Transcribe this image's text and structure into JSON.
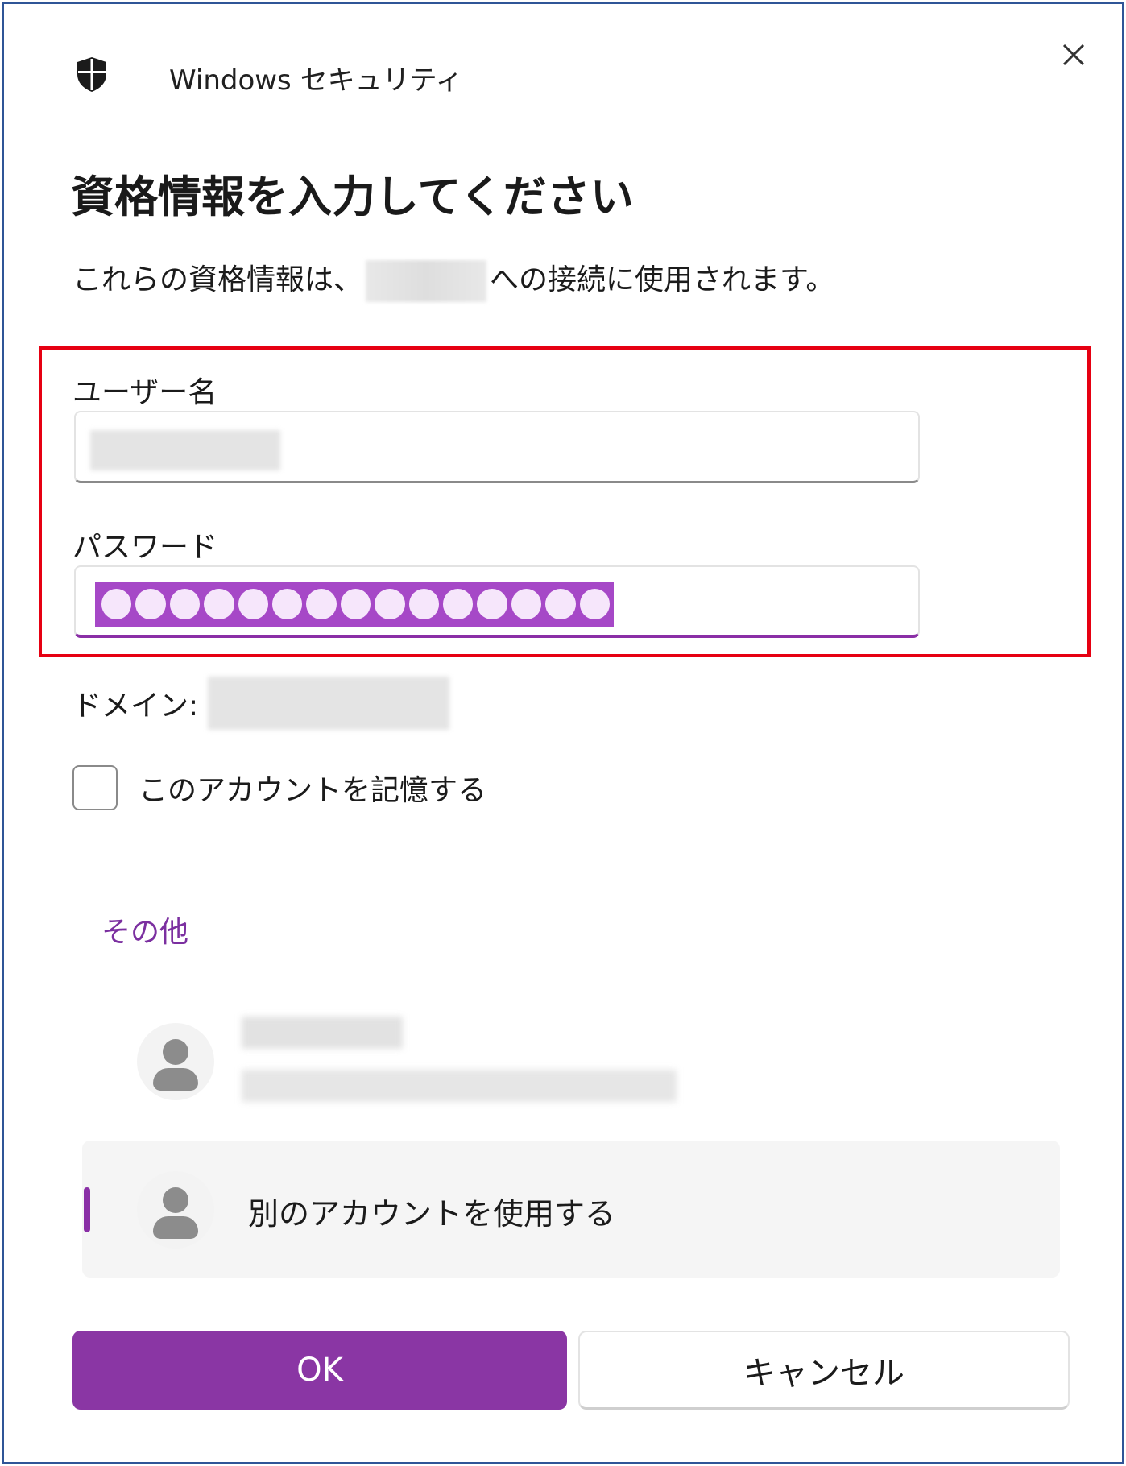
{
  "window": {
    "app_title": "Windows セキュリティ",
    "close_symbol": "✕"
  },
  "dialog": {
    "heading": "資格情報を入力してください",
    "subtext_before": "これらの資格情報は、",
    "subtext_after": "への接続に使用されます。"
  },
  "form": {
    "username_label": "ユーザー名",
    "password_label": "パスワード",
    "password_mask_count": 15,
    "domain_label": "ドメイン:",
    "remember_label": "このアカウントを記憶する",
    "remember_checked": false
  },
  "more": {
    "label": "その他",
    "other_account_label": "別のアカウントを使用する"
  },
  "buttons": {
    "ok_label": "OK",
    "cancel_label": "キャンセル"
  },
  "colors": {
    "accent": "#8a36a4",
    "highlight_border": "#e60012",
    "frame_border": "#2f5597"
  },
  "icons": {
    "app": "shield-icon",
    "close": "close-icon",
    "avatar": "person-icon"
  }
}
